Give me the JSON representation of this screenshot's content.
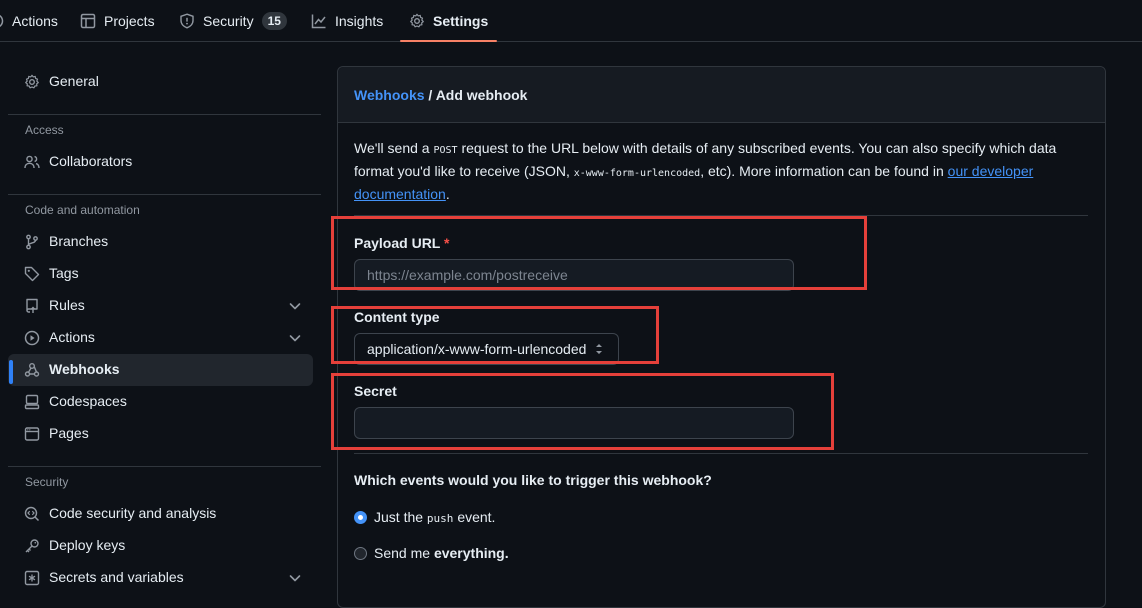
{
  "nav": {
    "tabs": [
      {
        "label": "Actions",
        "icon": "play-icon"
      },
      {
        "label": "Projects",
        "icon": "table-icon"
      },
      {
        "label": "Security",
        "icon": "shield-icon",
        "count": "15"
      },
      {
        "label": "Insights",
        "icon": "graph-icon"
      },
      {
        "label": "Settings",
        "icon": "gear-icon",
        "selected": true
      }
    ]
  },
  "sidebar": {
    "general": "General",
    "access_heading": "Access",
    "collaborators": "Collaborators",
    "code_heading": "Code and automation",
    "branches": "Branches",
    "tags": "Tags",
    "rules": "Rules",
    "actions": "Actions",
    "webhooks": "Webhooks",
    "codespaces": "Codespaces",
    "pages": "Pages",
    "security_heading": "Security",
    "code_security": "Code security and analysis",
    "deploy_keys": "Deploy keys",
    "secrets": "Secrets and variables"
  },
  "main": {
    "breadcrumb_link": "Webhooks",
    "breadcrumb_sep": "/",
    "breadcrumb_current": "Add webhook",
    "intro_1": "We'll send a",
    "intro_code_post": "POST",
    "intro_2": "request to the URL below with details of any subscribed events. You can also specify which data format you'd like to receive (JSON,",
    "intro_code_form": "x-www-form-urlencoded",
    "intro_3": ", etc). More information can be found in",
    "intro_link": "our developer documentation",
    "intro_end": ".",
    "payload_label": "Payload URL",
    "required_mark": "*",
    "payload_placeholder": "https://example.com/postreceive",
    "content_type_label": "Content type",
    "content_type_value": "application/x-www-form-urlencoded",
    "secret_label": "Secret",
    "secret_value": "",
    "events_question": "Which events would you like to trigger this webhook?",
    "radio_push_1": "Just the",
    "radio_push_code": "push",
    "radio_push_2": "event.",
    "radio_all_1": "Send me",
    "radio_all_2": "everything."
  },
  "colors": {
    "accent": "#4493f8",
    "tab_underline": "#f78166",
    "annotation": "#e5403a",
    "required": "#f85149"
  }
}
